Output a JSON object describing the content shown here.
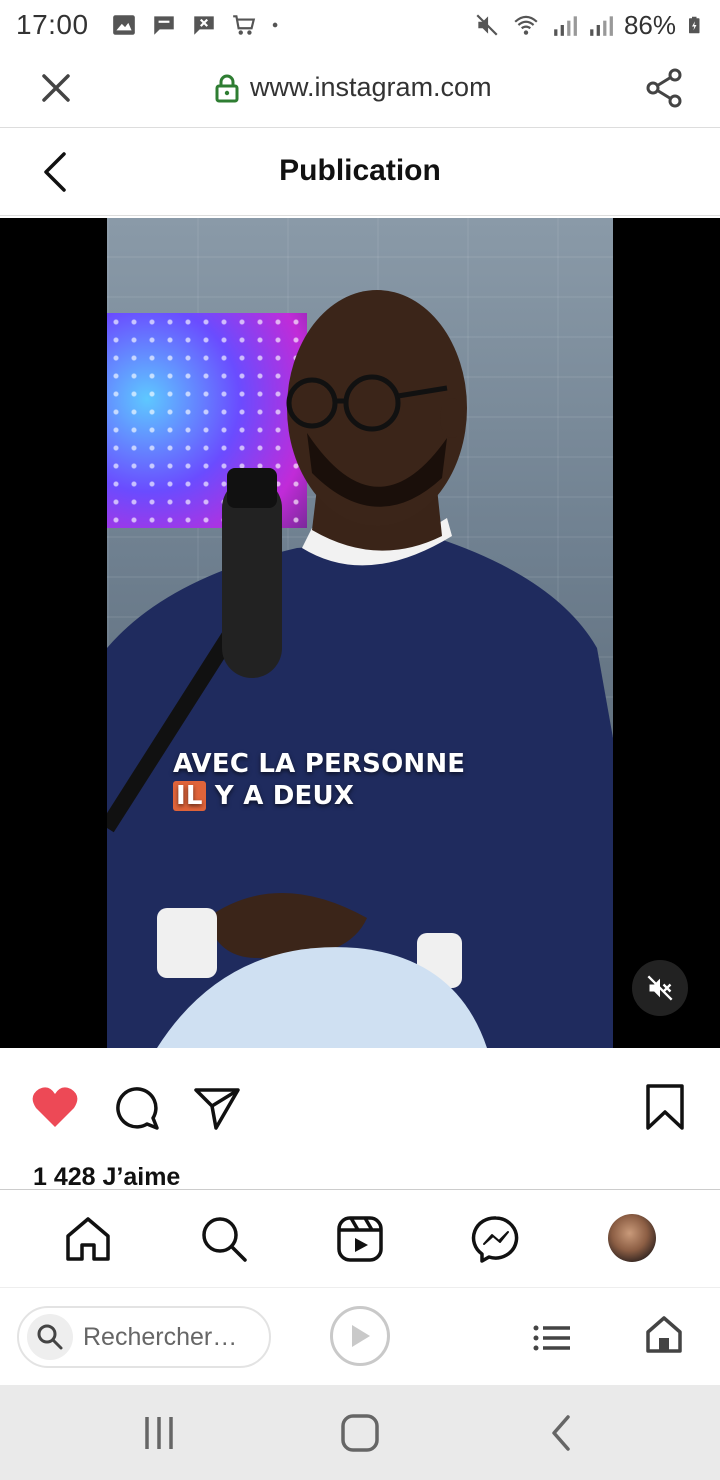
{
  "status_bar": {
    "time": "17:00",
    "battery": "86%",
    "notif_icons": [
      "gallery-icon",
      "message-icon",
      "x-message-icon",
      "cart-icon",
      "dot-icon"
    ],
    "sys_icons": [
      "mute-icon",
      "wifi-icon",
      "signal-icon",
      "signal-icon",
      "battery-charging-icon"
    ]
  },
  "browser": {
    "url": "www.instagram.com",
    "close_icon": "close-icon",
    "share_icon": "share-icon",
    "lock_color": "#2e7d32"
  },
  "post": {
    "header_title": "Publication",
    "caption_line1": "AVEC LA PERSONNE",
    "caption_line2_highlight": "IL",
    "caption_line2_rest": "Y A DEUX",
    "likes": "1 428 J’aime",
    "like_color": "#ed4956"
  },
  "instagram_nav": {
    "items": [
      "home-icon",
      "search-icon",
      "reels-icon",
      "messenger-icon",
      "profile-avatar"
    ]
  },
  "browser_toolbar": {
    "search_placeholder": "Rechercher…"
  }
}
